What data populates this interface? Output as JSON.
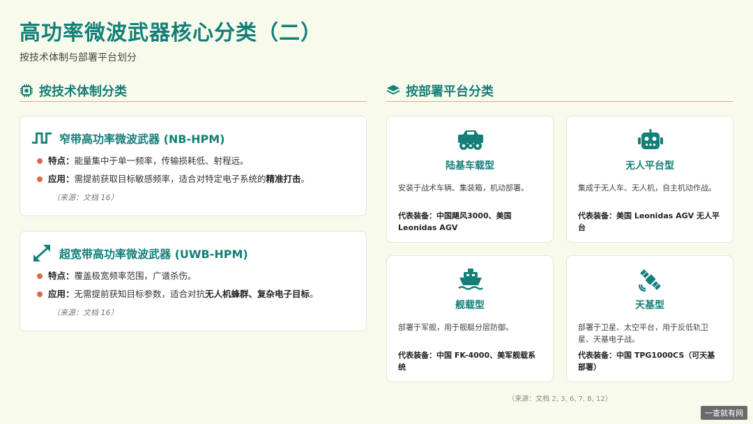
{
  "page": {
    "title": "高功率微波武器核心分类（二）",
    "subtitle": "按技术体制与部署平台划分"
  },
  "sections": {
    "tech": {
      "label": "按技术体制分类",
      "icon": "chip-icon"
    },
    "platform": {
      "label": "按部署平台分类",
      "icon": "layers-icon"
    }
  },
  "tech_cards": [
    {
      "title": "窄带高功率微波武器 (NB-HPM)",
      "icon": "square-wave-icon",
      "feature_label": "特点：",
      "feature_text": "能量集中于单一频率，传输损耗低、射程远。",
      "app_label": "应用：",
      "app_text_a": "需提前获取目标敏感频率，适合对特定电子系统的",
      "app_bold": "精准打击",
      "app_text_b": "。",
      "source": "（来源：文档 16）"
    },
    {
      "title": "超宽带高功率微波武器 (UWB-HPM)",
      "icon": "expand-arrows-icon",
      "feature_label": "特点：",
      "feature_text": "覆盖极宽频率范围，广谱杀伤。",
      "app_label": "应用：",
      "app_text_a": "无需提前获知目标参数，适合对抗",
      "app_bold": "无人机蜂群、复杂电子目标",
      "app_text_b": "。",
      "source": "（来源：文档 16）"
    }
  ],
  "platform_cards": [
    {
      "title": "陆基车载型",
      "icon": "truck-icon",
      "desc": "安装于战术车辆、集装箱，机动部署。",
      "rep_label": "代表装备：",
      "rep_text": "中国飓风3000、美国 Leonidas AGV"
    },
    {
      "title": "无人平台型",
      "icon": "robot-icon",
      "desc": "集成于无人车、无人机，自主机动作战。",
      "rep_label": "代表装备：",
      "rep_text": "美国 Leonidas AGV 无人平台"
    },
    {
      "title": "舰载型",
      "icon": "ship-icon",
      "desc": "部署于军舰，用于舰艇分层防御。",
      "rep_label": "代表装备：",
      "rep_text": "中国 FK-4000、美军舰载系统"
    },
    {
      "title": "天基型",
      "icon": "satellite-icon",
      "desc": "部署于卫星、太空平台，用于反低轨卫星、天基电子战。",
      "rep_label": "代表装备：",
      "rep_text": "中国 TPG1000CS（可天基部署）"
    }
  ],
  "footer": {
    "source": "（来源：文档 2, 3, 6, 7, 8, 12）",
    "watermark": "一查就有网"
  },
  "colors": {
    "accent": "#137f78",
    "bullet": "#d9694a",
    "divider": "#e6a889",
    "background": "#f8fbec"
  }
}
